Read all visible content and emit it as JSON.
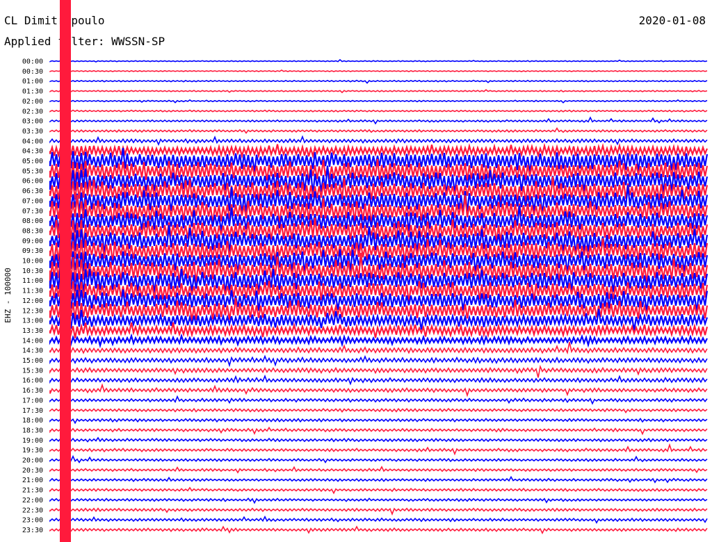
{
  "header": {
    "station": "CL Dimitropoulo",
    "date": "2020-01-08",
    "filter_text": "Applied filter: WWSSN-SP"
  },
  "channel_label": "EHZ - 100000",
  "chart_data": {
    "type": "line",
    "title": "",
    "colors": [
      "#0000ff",
      "#ff1a3c"
    ],
    "rows": [
      {
        "time": "00:00",
        "activity": 0.15
      },
      {
        "time": "00:30",
        "activity": 0.15
      },
      {
        "time": "01:00",
        "activity": 0.2
      },
      {
        "time": "01:30",
        "activity": 0.2
      },
      {
        "time": "02:00",
        "activity": 0.2
      },
      {
        "time": "02:30",
        "activity": 0.25
      },
      {
        "time": "03:00",
        "activity": 0.3
      },
      {
        "time": "03:30",
        "activity": 0.35
      },
      {
        "time": "04:00",
        "activity": 0.55
      },
      {
        "time": "04:30",
        "activity": 1.4
      },
      {
        "time": "05:00",
        "activity": 2.4
      },
      {
        "time": "05:30",
        "activity": 2.6
      },
      {
        "time": "06:00",
        "activity": 2.6
      },
      {
        "time": "06:30",
        "activity": 2.6
      },
      {
        "time": "07:00",
        "activity": 2.6
      },
      {
        "time": "07:30",
        "activity": 2.6
      },
      {
        "time": "08:00",
        "activity": 2.6
      },
      {
        "time": "08:30",
        "activity": 2.6
      },
      {
        "time": "09:00",
        "activity": 2.6
      },
      {
        "time": "09:30",
        "activity": 2.6
      },
      {
        "time": "10:00",
        "activity": 2.6
      },
      {
        "time": "10:30",
        "activity": 2.6
      },
      {
        "time": "11:00",
        "activity": 2.6
      },
      {
        "time": "11:30",
        "activity": 2.5
      },
      {
        "time": "12:00",
        "activity": 2.4
      },
      {
        "time": "12:30",
        "activity": 2.2
      },
      {
        "time": "13:00",
        "activity": 1.8
      },
      {
        "time": "13:30",
        "activity": 1.4
      },
      {
        "time": "14:00",
        "activity": 1.0
      },
      {
        "time": "14:30",
        "activity": 0.8
      },
      {
        "time": "15:00",
        "activity": 0.75
      },
      {
        "time": "15:30",
        "activity": 0.7
      },
      {
        "time": "16:00",
        "activity": 0.65
      },
      {
        "time": "16:30",
        "activity": 0.6
      },
      {
        "time": "17:00",
        "activity": 0.5
      },
      {
        "time": "17:30",
        "activity": 0.45
      },
      {
        "time": "18:00",
        "activity": 0.45
      },
      {
        "time": "18:30",
        "activity": 0.45
      },
      {
        "time": "19:00",
        "activity": 0.45
      },
      {
        "time": "19:30",
        "activity": 0.45
      },
      {
        "time": "20:00",
        "activity": 0.4
      },
      {
        "time": "20:30",
        "activity": 0.4
      },
      {
        "time": "21:00",
        "activity": 0.4
      },
      {
        "time": "21:30",
        "activity": 0.4
      },
      {
        "time": "22:00",
        "activity": 0.4
      },
      {
        "time": "22:30",
        "activity": 0.45
      },
      {
        "time": "23:00",
        "activity": 0.45
      },
      {
        "time": "23:30",
        "activity": 0.45
      }
    ]
  }
}
